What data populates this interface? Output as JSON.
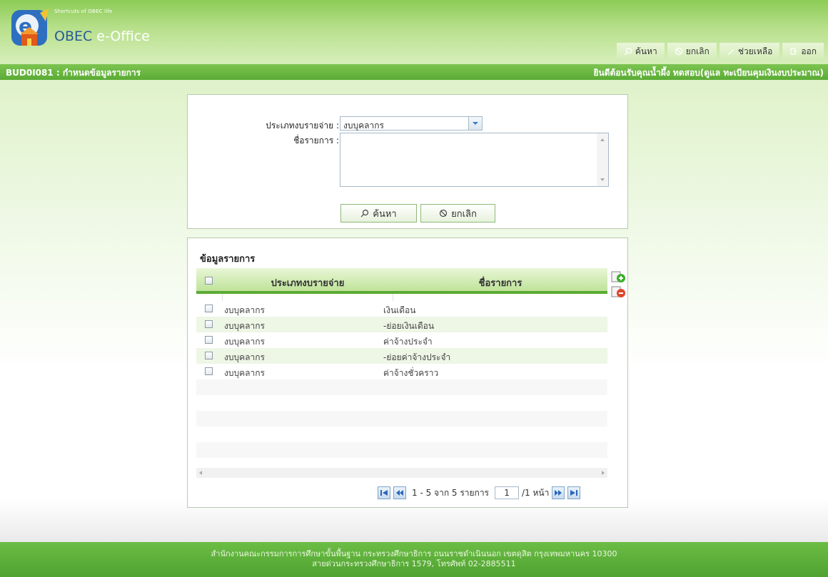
{
  "header": {
    "logo_small": "Shortcuts of OBEC life",
    "logo_title_a": "OBEC",
    "logo_title_b": " e-Office",
    "menu": [
      {
        "label": "ค้นหา",
        "icon": "search-icon"
      },
      {
        "label": "ยกเลิก",
        "icon": "cancel-icon"
      },
      {
        "label": "ช่วยเหลือ",
        "icon": "help-icon"
      },
      {
        "label": "ออก",
        "icon": "exit-icon"
      }
    ]
  },
  "title_bar": {
    "page_code_title": "BUD0I081 : กำหนดข้อมูลรายการ",
    "welcome": "ยินดีต้อนรับคุณน้ำผึ้ง ทดสอบ(ดูแล ทะเบียนคุมเงินงบประมาณ)"
  },
  "search_form": {
    "expense_type_label": "ประเภทงบรายจ่าย :",
    "expense_type_value": "งบบุคลากร",
    "item_name_label": "ชื่อรายการ :",
    "item_name_value": "",
    "search_button": "ค้นหา",
    "cancel_button": "ยกเลิก"
  },
  "list": {
    "title": "ข้อมูลรายการ",
    "columns": [
      "ประเภทงบรายจ่าย",
      "ชื่อรายการ"
    ],
    "rows": [
      {
        "type": "งบบุคลากร",
        "name": "เงินเดือน"
      },
      {
        "type": "งบบุคลากร",
        "name": "-ย่อยเงินเดือน"
      },
      {
        "type": "งบบุคลากร",
        "name": "ค่าจ้างประจำ"
      },
      {
        "type": "งบบุคลากร",
        "name": "-ย่อยค่าจ้างประจำ"
      },
      {
        "type": "งบบุคลากร",
        "name": "ค่าจ้างชั่วคราว"
      }
    ],
    "pager": {
      "summary": "1 - 5 จาก 5 รายการ",
      "page": "1",
      "total_pages": "/1 หน้า"
    }
  },
  "footer": {
    "line1": "สำนักงานคณะกรรมการการศึกษาขั้นพื้นฐาน กระทรวงศึกษาธิการ ถนนราชดำเนินนอก เขตดุสิต กรุงเทพมหานคร 10300",
    "line2": "สายด่วนกระทรวงศึกษาธิการ 1579, โทรศัพท์ 02-2885511"
  },
  "colors": {
    "brand_green": "#5aab35",
    "header_light_green": "#c6e8a4",
    "link_blue": "#2a5a9a"
  }
}
